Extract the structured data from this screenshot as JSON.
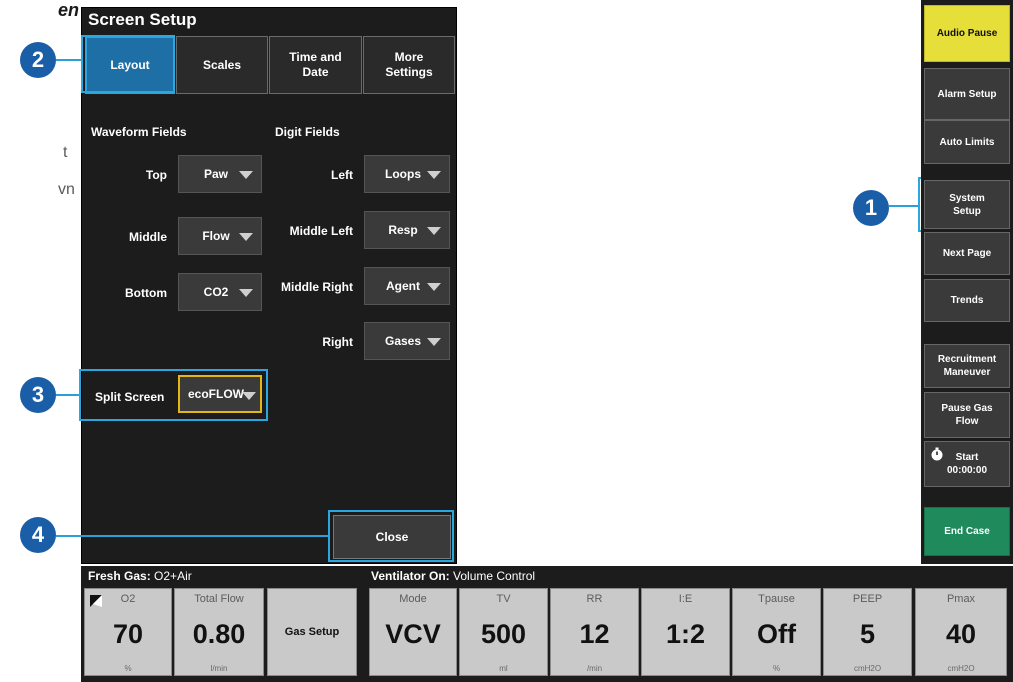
{
  "page": {
    "title_fragment": "en",
    "text_fragments": [
      "t",
      "vn"
    ]
  },
  "callouts": [
    "1",
    "2",
    "3",
    "4"
  ],
  "screen_setup": {
    "title": "Screen Setup",
    "tabs": [
      {
        "label": "Layout",
        "active": true
      },
      {
        "label": "Scales"
      },
      {
        "label": "Time and Date"
      },
      {
        "label": "More Settings"
      }
    ],
    "waveform_heading": "Waveform Fields",
    "digit_heading": "Digit Fields",
    "waveform_fields": [
      {
        "label": "Top",
        "value": "Paw"
      },
      {
        "label": "Middle",
        "value": "Flow"
      },
      {
        "label": "Bottom",
        "value": "CO2"
      }
    ],
    "digit_fields": [
      {
        "label": "Left",
        "value": "Loops"
      },
      {
        "label": "Middle Left",
        "value": "Resp"
      },
      {
        "label": "Middle Right",
        "value": "Agent"
      },
      {
        "label": "Right",
        "value": "Gases"
      }
    ],
    "split_screen": {
      "label": "Split Screen",
      "value": "ecoFLOW"
    },
    "close_label": "Close"
  },
  "right_menu": {
    "buttons": [
      "Audio Pause",
      "Alarm Setup",
      "Auto Limits",
      "System Setup",
      "Next Page",
      "Trends",
      "Recruitment Maneuver",
      "Pause Gas Flow"
    ],
    "timer": {
      "label": "Start",
      "time": "00:00:00"
    },
    "end_case": "End Case"
  },
  "fresh_gas": {
    "label": "Fresh Gas:",
    "value": "O2+Air",
    "tiles": [
      {
        "label": "O2",
        "value": "70",
        "unit": "%"
      },
      {
        "label": "Total Flow",
        "value": "0.80",
        "unit": "l/min"
      }
    ],
    "gas_setup": "Gas Setup"
  },
  "ventilator": {
    "label": "Ventilator On:",
    "value": "Volume Control",
    "tiles": [
      {
        "label": "Mode",
        "value": "VCV",
        "unit": ""
      },
      {
        "label": "TV",
        "value": "500",
        "unit": "ml"
      },
      {
        "label": "RR",
        "value": "12",
        "unit": "/min"
      },
      {
        "label": "I:E",
        "value": "1:2",
        "unit": ""
      },
      {
        "label": "Tpause",
        "value": "Off",
        "unit": "%"
      },
      {
        "label": "PEEP",
        "value": "5",
        "unit": "cmH2O"
      },
      {
        "label": "Pmax",
        "value": "40",
        "unit": "cmH2O"
      }
    ]
  },
  "colors": {
    "callout": "#1b5ea8",
    "highlight": "#2aa7e0",
    "audio_pause": "#e6df3a",
    "end_case": "#1f8a5b",
    "split_border": "#e2b616",
    "active_tab": "#1e6fa6"
  }
}
